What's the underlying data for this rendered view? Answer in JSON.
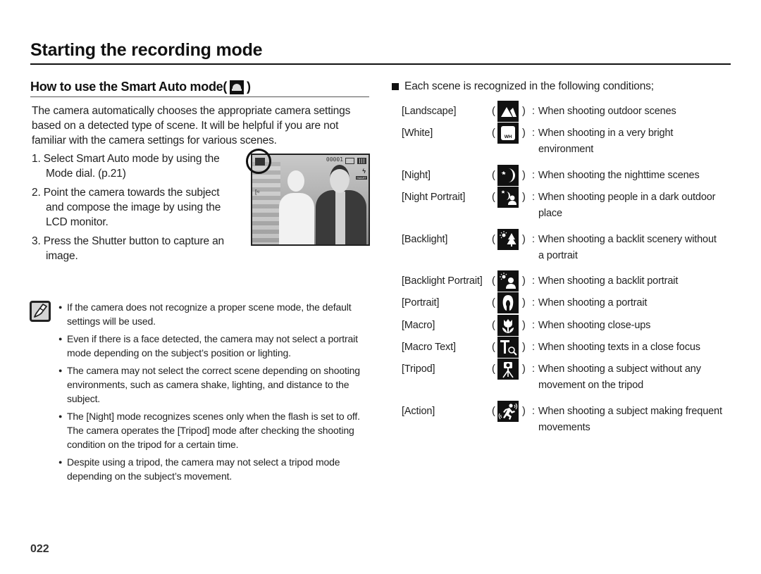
{
  "page": {
    "title": "Starting the recording mode",
    "page_number": "022"
  },
  "left": {
    "section_title": "How to use the Smart Auto mode(",
    "section_title_close": ")",
    "section_icon": "smart-auto-mode-icon",
    "intro": "The camera automatically chooses the appropriate camera settings based on a detected type of scene. It will be helpful if you are not familiar with the camera settings for various scenes.",
    "steps": [
      "1. Select Smart Auto mode by using the Mode dial. (p.21)",
      "2. Point the camera towards the subject and compose the image by using the LCD monitor.",
      "3. Press the Shutter button to capture an image."
    ],
    "photo": {
      "description": "LCD preview of a bride and groom with Smart Auto icon circled",
      "osd_shot_count": "00001"
    },
    "note_icon": "note-pencil-icon",
    "notes": [
      "If the camera does not recognize a proper scene mode, the default settings will be used.",
      "Even if there is a face detected, the camera may not select a portrait mode depending on the subject’s position or lighting.",
      "The camera may not select the correct scene depending on shooting environments, such as camera shake, lighting, and distance to the subject.",
      "The [Night] mode recognizes scenes only when the flash is set to off. The camera operates the [Tripod] mode after checking the shooting condition on the tripod for a certain time.",
      "Despite using a tripod, the camera may not select a tripod mode depending on the subject’s movement."
    ]
  },
  "right": {
    "intro": "Each scene is recognized in the following conditions;",
    "lp": "(",
    "rp": ")",
    "colon": ":",
    "scenes": [
      {
        "name": "[Landscape]",
        "icon": "landscape-icon",
        "desc": "When shooting outdoor scenes",
        "desc2": ""
      },
      {
        "name": "[White]",
        "icon": "white-icon",
        "desc": "When shooting in a very bright",
        "desc2": "environment"
      },
      {
        "name": "[Night]",
        "icon": "night-icon",
        "desc": "When shooting the nighttime scenes",
        "desc2": ""
      },
      {
        "name": "[Night Portrait]",
        "icon": "night-portrait-icon",
        "desc": "When shooting people in a dark outdoor",
        "desc2": "place"
      },
      {
        "name": "[Backlight]",
        "icon": "backlight-icon",
        "desc": "When shooting a backlit scenery without",
        "desc2": "a portrait"
      },
      {
        "name": "[Backlight Portrait]",
        "icon": "backlight-portrait-icon",
        "desc": "When shooting a backlit portrait",
        "desc2": ""
      },
      {
        "name": "[Portrait]",
        "icon": "portrait-icon",
        "desc": "When shooting a portrait",
        "desc2": ""
      },
      {
        "name": "[Macro]",
        "icon": "macro-icon",
        "desc": "When shooting close-ups",
        "desc2": ""
      },
      {
        "name": "[Macro Text]",
        "icon": "macro-text-icon",
        "desc": "When shooting texts in a close focus",
        "desc2": ""
      },
      {
        "name": "[Tripod]",
        "icon": "tripod-icon",
        "desc": "When shooting a subject without any",
        "desc2": "movement on the tripod"
      },
      {
        "name": "[Action]",
        "icon": "action-icon",
        "desc": "When shooting a subject making frequent",
        "desc2": "movements"
      }
    ]
  }
}
